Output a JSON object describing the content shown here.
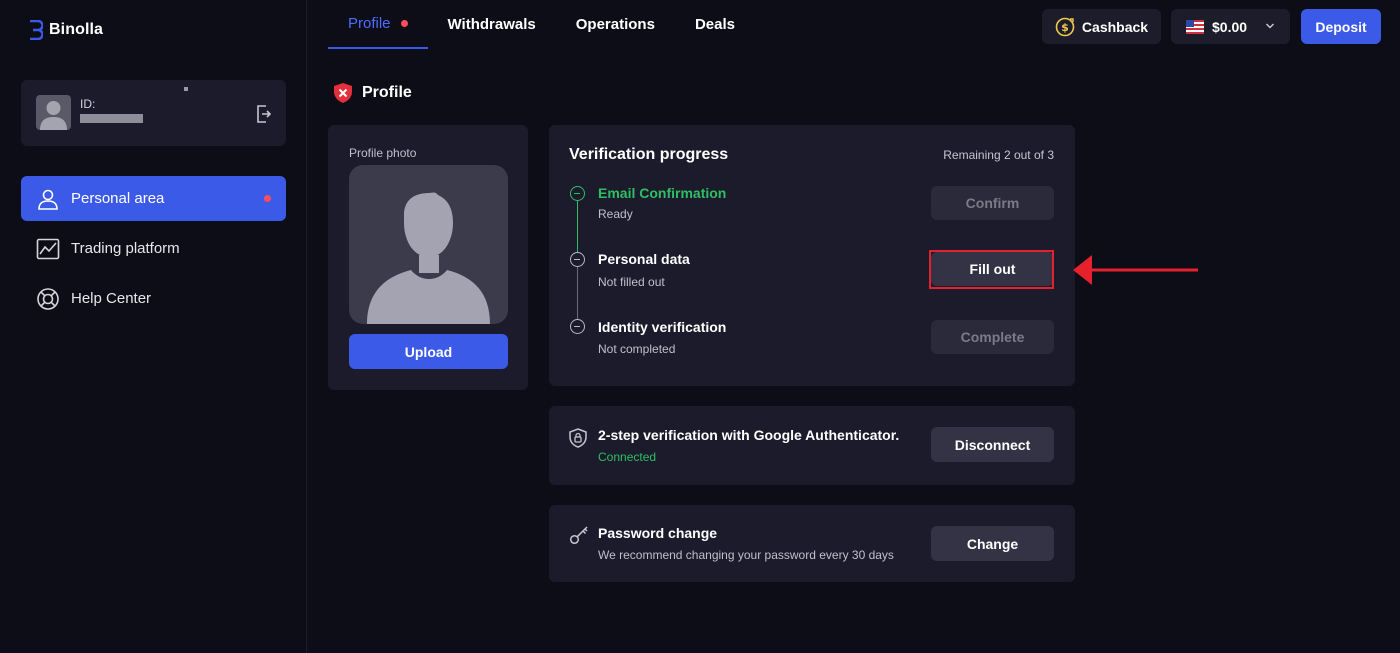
{
  "brand": {
    "name": "Binolla",
    "accent": "#3b5ae8"
  },
  "user": {
    "id_label": "ID:"
  },
  "sidebar": {
    "items": [
      {
        "label": "Personal area",
        "icon": "user-icon",
        "active": true
      },
      {
        "label": "Trading platform",
        "icon": "chart-icon",
        "active": false
      },
      {
        "label": "Help Center",
        "icon": "lifebuoy-icon",
        "active": false
      }
    ]
  },
  "tabs": [
    {
      "label": "Profile",
      "active": true
    },
    {
      "label": "Withdrawals",
      "active": false
    },
    {
      "label": "Operations",
      "active": false
    },
    {
      "label": "Deals",
      "active": false
    }
  ],
  "header": {
    "cashback_label": "Cashback",
    "balance": "$0.00",
    "deposit_label": "Deposit"
  },
  "profile": {
    "title": "Profile",
    "photo_label": "Profile photo",
    "upload_label": "Upload"
  },
  "verification": {
    "title": "Verification progress",
    "remaining": "Remaining 2 out of 3",
    "steps": [
      {
        "title": "Email Confirmation",
        "status": "Ready",
        "button": "Confirm",
        "done": true
      },
      {
        "title": "Personal data",
        "status": "Not filled out",
        "button": "Fill out",
        "done": false
      },
      {
        "title": "Identity verification",
        "status": "Not completed",
        "button": "Complete",
        "done": false
      }
    ]
  },
  "two_factor": {
    "title": "2-step verification with Google Authenticator.",
    "status": "Connected",
    "button": "Disconnect"
  },
  "password": {
    "title": "Password change",
    "subtitle": "We recommend changing your password every 30 days",
    "button": "Change"
  },
  "colors": {
    "success": "#2fbf63",
    "alert": "#ff4d5e",
    "highlight": "#e4212d"
  }
}
